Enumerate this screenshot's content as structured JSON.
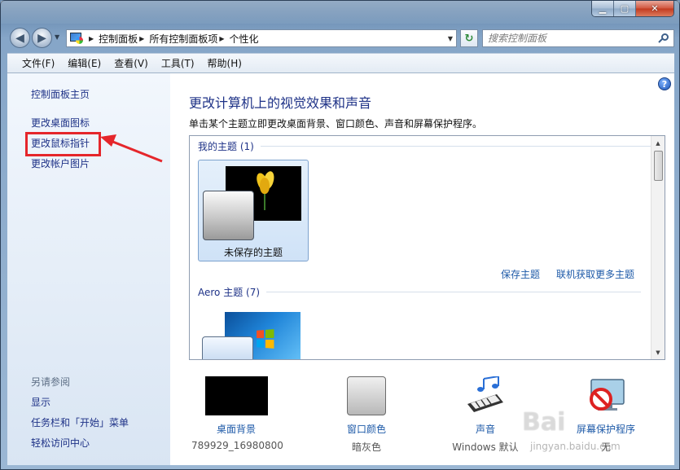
{
  "window": {
    "caption_buttons": [
      "minimize",
      "maximize",
      "close"
    ]
  },
  "nav": {
    "breadcrumbs": [
      "控制面板",
      "所有控制面板项",
      "个性化"
    ],
    "search_placeholder": "搜索控制面板"
  },
  "menu": {
    "items": [
      "文件(F)",
      "编辑(E)",
      "查看(V)",
      "工具(T)",
      "帮助(H)"
    ]
  },
  "sidebar": {
    "links": [
      "控制面板主页",
      "更改桌面图标",
      "更改鼠标指针",
      "更改帐户图片"
    ],
    "see_also_title": "另请参阅",
    "see_also": [
      "显示",
      "任务栏和「开始」菜单",
      "轻松访问中心"
    ]
  },
  "main": {
    "heading": "更改计算机上的视觉效果和声音",
    "subtitle": "单击某个主题立即更改桌面背景、窗口颜色、声音和屏幕保护程序。",
    "my_themes_label": "我的主题 (1)",
    "unsaved_theme": "未保存的主题",
    "save_theme": "保存主题",
    "get_more_themes": "联机获取更多主题",
    "aero_label": "Aero 主题 (7)"
  },
  "options": [
    {
      "label": "桌面背景",
      "value": "789929_16980800",
      "icon": "desktop-background-icon"
    },
    {
      "label": "窗口颜色",
      "value": "暗灰色",
      "icon": "window-color-icon"
    },
    {
      "label": "声音",
      "value": "Windows 默认",
      "icon": "sound-icon"
    },
    {
      "label": "屏幕保护程序",
      "value": "无",
      "icon": "screensaver-icon"
    }
  ],
  "annotation": {
    "color": "#e5262b"
  },
  "watermark": {
    "text": "Bai",
    "sub": "jingyan.baidu.com"
  }
}
